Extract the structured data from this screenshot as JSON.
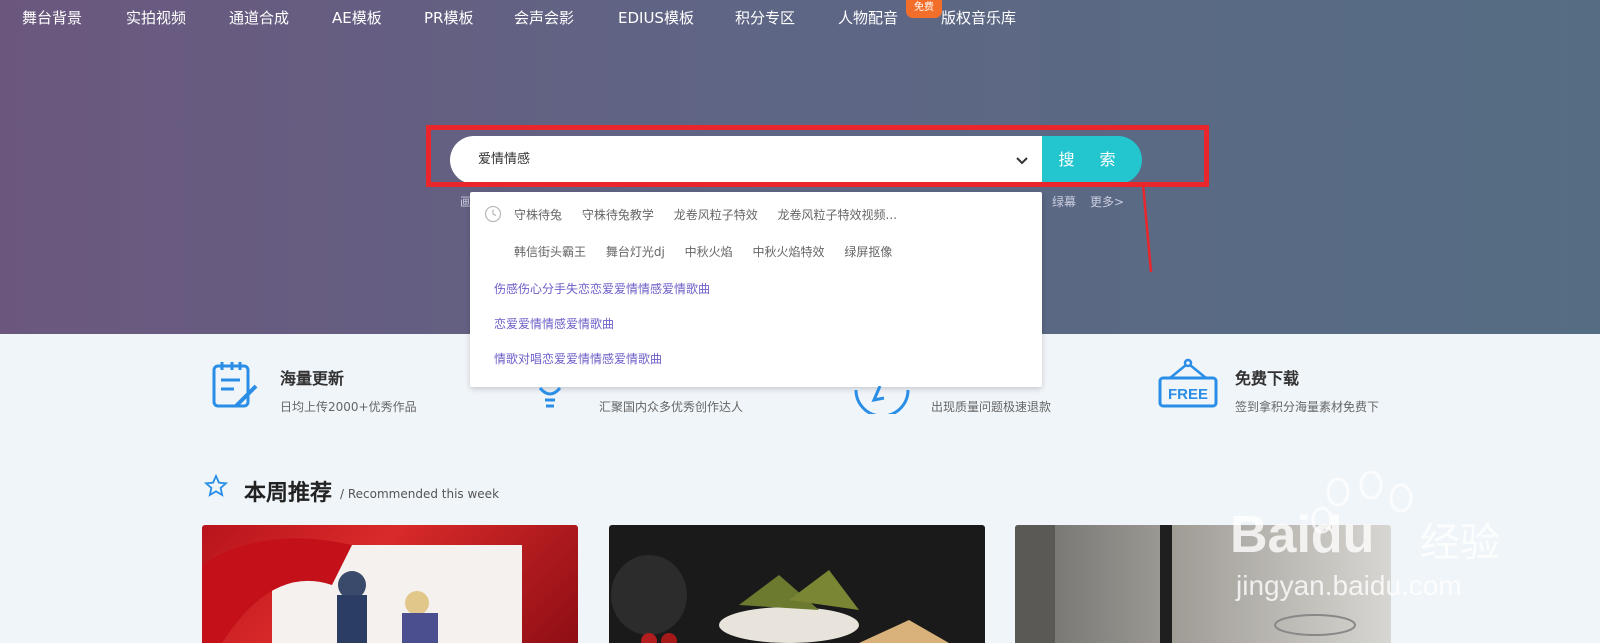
{
  "nav": {
    "items": [
      {
        "label": "舞台背景"
      },
      {
        "label": "实拍视频"
      },
      {
        "label": "通道合成"
      },
      {
        "label": "AE模板"
      },
      {
        "label": "PR模板"
      },
      {
        "label": "会声会影"
      },
      {
        "label": "EDIUS模板"
      },
      {
        "label": "积分专区"
      },
      {
        "label": "人物配音"
      },
      {
        "label": "版权音乐库"
      }
    ],
    "badge": "免费"
  },
  "search": {
    "value": "爱情情感",
    "button_label": "搜 索",
    "behind_left": "画",
    "behind_right": [
      "绿幕",
      "更多>"
    ]
  },
  "dropdown": {
    "history_row1": [
      "守株待兔",
      "守株待兔教学",
      "龙卷风粒子特效",
      "龙卷风粒子特效视频..."
    ],
    "history_row2": [
      "韩信街头霸王",
      "舞台灯光dj",
      "中秋火焰",
      "中秋火焰特效",
      "绿屏抠像"
    ],
    "suggestions": [
      "伤感伤心分手失恋恋爱爱情情感爱情歌曲",
      "恋爱爱情情感爱情歌曲",
      "情歌对唱恋爱爱情情感爱情歌曲"
    ]
  },
  "features": [
    {
      "title": "海量更新",
      "desc": "日均上传2000+优秀作品",
      "icon": "notepad-pencil-icon"
    },
    {
      "title": "",
      "desc": "汇聚国内众多优秀创作达人",
      "icon": "lightbulb-icon"
    },
    {
      "title": "",
      "desc": "出现质量问题极速退款",
      "icon": "lightning-circle-icon"
    },
    {
      "title": "免费下载",
      "desc": "签到拿积分海量素材免费下",
      "icon": "free-sign-icon",
      "icon_text": "FREE"
    }
  ],
  "section": {
    "title": "本周推荐",
    "subtitle": "/ Recommended this week"
  },
  "watermark": {
    "brand": "Bai",
    "brand2": "du",
    "cn": "经验",
    "url": "jingyan.baidu.com"
  },
  "colors": {
    "accent": "#23c6cf",
    "badge": "#f36e2a",
    "highlight": "#e8262c",
    "suggest": "#6c5fc8"
  }
}
